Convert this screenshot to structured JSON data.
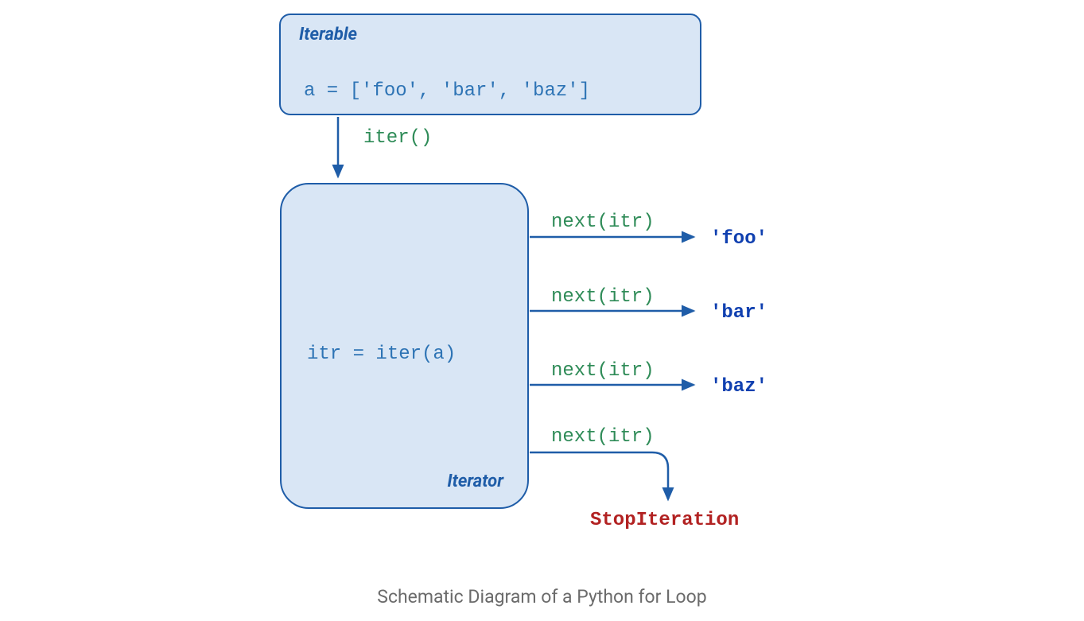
{
  "iterable": {
    "title": "Iterable",
    "code": "a = ['foo', 'bar', 'baz']"
  },
  "iterator": {
    "title": "Iterator",
    "code": "itr = iter(a)"
  },
  "iter_call": "iter()",
  "next_calls": {
    "call_1": "next(itr)",
    "call_2": "next(itr)",
    "call_3": "next(itr)",
    "call_4": "next(itr)"
  },
  "outputs": {
    "foo": "'foo'",
    "bar": "'bar'",
    "baz": "'baz'"
  },
  "stop_iteration": "StopIteration",
  "caption": "Schematic Diagram of a Python for Loop",
  "colors": {
    "box_fill": "#d9e6f5",
    "box_border": "#1f5da8",
    "code_blue": "#2e74b5",
    "label_green": "#2e8b57",
    "output_blue": "#1040b0",
    "error_red": "#b22222",
    "caption_gray": "#6b6b6b"
  }
}
